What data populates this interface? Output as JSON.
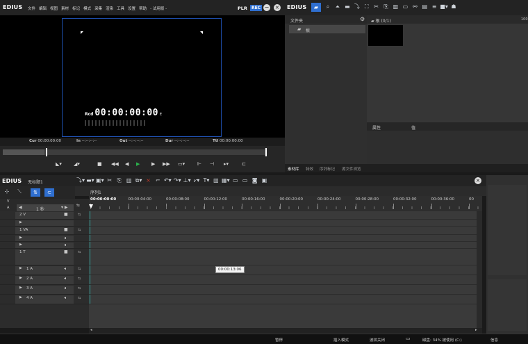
{
  "player": {
    "logo": "EDIUS",
    "menu": [
      "文件",
      "编辑",
      "视图",
      "素材",
      "标记",
      "模式",
      "采集",
      "渲染",
      "工具",
      "设置",
      "帮助",
      "- 试用版 -"
    ],
    "plr": "PLR",
    "rec": "REC",
    "overlay_label": "Rcd",
    "overlay_timecode": "00:00:00:00",
    "overlay_suffix": "E",
    "info": {
      "cur_label": "Cur",
      "cur_value": "00:00:00:00",
      "in_label": "In",
      "in_value": "--:--:--:--",
      "out_label": "Out",
      "out_value": "--:--:--:--",
      "dur_label": "Dur",
      "dur_value": "--:--:--:--",
      "ttl_label": "Ttl",
      "ttl_value": "00:00:00:00"
    }
  },
  "bin": {
    "logo": "EDIUS",
    "folder_header": "文件夹",
    "root_folder": "根",
    "clips_header": "根 (0/1)",
    "prop_col1": "属性",
    "prop_col2": "值",
    "tabs": [
      "素材库",
      "特效",
      "序列标记",
      "源文件浏览"
    ],
    "corner_value": "100"
  },
  "timeline": {
    "logo": "EDIUS",
    "project": "无标题1",
    "sequence": "序列1",
    "scale": "1 秒",
    "ruler": [
      "00:00:00:00",
      "00:00:04:00",
      "00:00:08:00",
      "00:00:12:00",
      "00:00:16:00",
      "00:00:20:00",
      "00:00:24:00",
      "00:00:28:00",
      "00:00:32:00",
      "00:00:36:00",
      "00"
    ],
    "tooltip": "00:00:13:06",
    "tracks": [
      {
        "name": "2 V"
      },
      {
        "name": ""
      },
      {
        "name": "1 VA"
      },
      {
        "name": ""
      },
      {
        "name": ""
      },
      {
        "name": "1 T"
      },
      {
        "name": "1 A"
      },
      {
        "name": "2 A"
      },
      {
        "name": "3 A"
      },
      {
        "name": "4 A"
      }
    ]
  },
  "status": {
    "pause": "暂停",
    "insert_mode": "插入模式",
    "ripple_off": "波纹关闭",
    "disk": "磁盘: 34% 被使用 (C:)",
    "info": "信息"
  },
  "colors": {
    "accent": "#2f6fd0",
    "rec": "#2f6fd0",
    "frame": "#1e4fae",
    "cursor": "#2aa19b"
  }
}
